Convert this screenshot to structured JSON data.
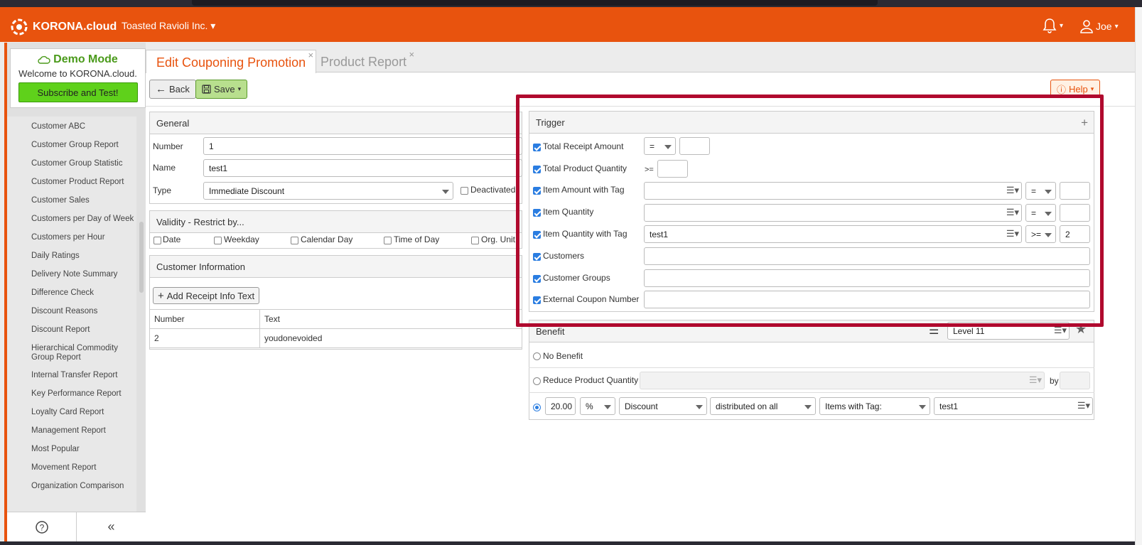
{
  "app": {
    "brand": "KORONA.cloud",
    "company": "Toasted Ravioli Inc.",
    "user": "Joe",
    "accent": "#e8530e"
  },
  "demo": {
    "title": "Demo Mode",
    "welcome": "Welcome to KORONA.cloud.",
    "subscribe": "Subscribe and Test!"
  },
  "sidebar": {
    "items": [
      "Customer ABC",
      "Customer Group Report",
      "Customer Group Statistic",
      "Customer Product Report",
      "Customer Sales",
      "Customers per Day of Week",
      "Customers per Hour",
      "Daily Ratings",
      "Delivery Note Summary",
      "Difference Check",
      "Discount Reasons",
      "Discount Report",
      "Hierarchical Commodity Group Report",
      "Internal Transfer Report",
      "Key Performance Report",
      "Loyalty Card Report",
      "Management Report",
      "Most Popular",
      "Movement Report",
      "Organization Comparison"
    ]
  },
  "tabs": {
    "active": "Edit Couponing Promotion",
    "inactive": "Product Report"
  },
  "toolbar": {
    "back": "Back",
    "save": "Save",
    "help": "Help"
  },
  "general": {
    "title": "General",
    "number_label": "Number",
    "number_value": "1",
    "name_label": "Name",
    "name_value": "test1",
    "type_label": "Type",
    "type_value": "Immediate Discount",
    "deactivated_label": "Deactivated"
  },
  "validity": {
    "title": "Validity - Restrict by...",
    "options": [
      "Date",
      "Weekday",
      "Calendar Day",
      "Time of Day",
      "Org. Unit"
    ]
  },
  "customer_info": {
    "title": "Customer Information",
    "add_button": "Add Receipt Info Text",
    "columns": [
      "Number",
      "Text"
    ],
    "rows": [
      [
        "2",
        "youdonevoided"
      ]
    ]
  },
  "trigger": {
    "title": "Trigger",
    "add": "+",
    "rows": [
      {
        "label": "Total Receipt Amount",
        "op": "=",
        "value": ""
      },
      {
        "label": "Total Product Quantity",
        "op": ">=",
        "value": ""
      },
      {
        "label": "Item Amount with Tag",
        "tag": "",
        "op": "=",
        "value": ""
      },
      {
        "label": "Item Quantity",
        "tag": "",
        "op": "=",
        "value": ""
      },
      {
        "label": "Item Quantity with Tag",
        "tag": "test1",
        "op": ">=",
        "value": "2"
      },
      {
        "label": "Customers",
        "value": ""
      },
      {
        "label": "Customer Groups",
        "value": ""
      },
      {
        "label": "External Coupon Number",
        "value": ""
      }
    ]
  },
  "benefit": {
    "title": "Benefit",
    "level": "Level 11",
    "no_benefit": "No Benefit",
    "reduce": "Reduce Product Quantity",
    "by": "by",
    "amount": "20.00",
    "unit": "%",
    "kind": "Discount",
    "distribution": "distributed on all",
    "target": "Items with Tag:",
    "tag": "test1"
  }
}
